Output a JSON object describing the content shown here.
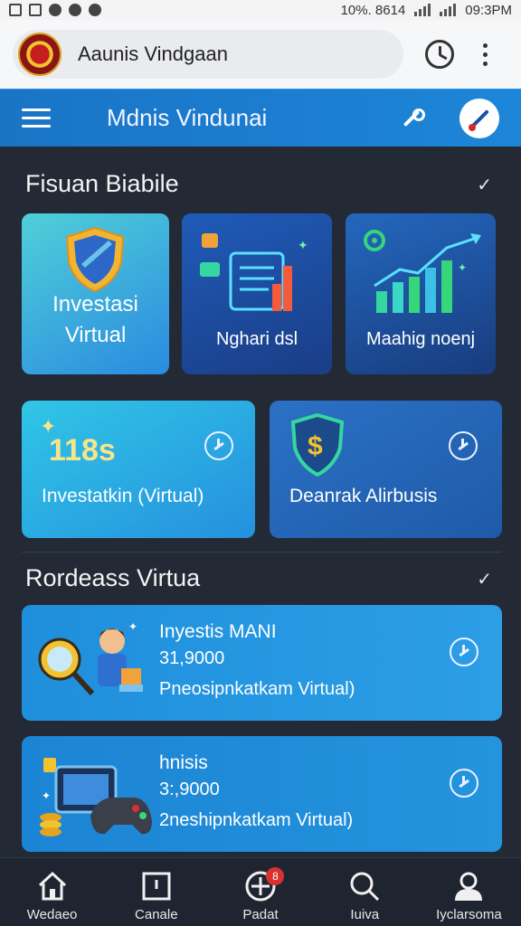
{
  "status_bar": {
    "time": "09:3PM",
    "battery_text": "10%. 8614"
  },
  "browser": {
    "url_text": "Aaunis Vindgaan"
  },
  "app_bar": {
    "title": "Mdnis Vindunai"
  },
  "section1": {
    "title": "Fisuan Biabile"
  },
  "cards": [
    {
      "label": "Investasi Virtual"
    },
    {
      "label": "Nghari dsl"
    },
    {
      "label": "Maahig noenj"
    },
    {
      "value": "118s",
      "label": "Investatkin (Virtual)"
    },
    {
      "label": "Deanrak Alirbusis"
    }
  ],
  "section2": {
    "title": "Rordeass Virtua"
  },
  "list": [
    {
      "title": "Inyestis MANI",
      "amount": "31,9000",
      "subtitle": "Pneosipnkatkam Virtual)"
    },
    {
      "title": "hnisis",
      "amount": "3:,9000",
      "subtitle": "2neshipnkatkam Virtual)"
    }
  ],
  "nav": [
    {
      "label": "Wedaeo",
      "icon": "home-icon"
    },
    {
      "label": "Canale",
      "icon": "calendar-icon"
    },
    {
      "label": "Padat",
      "icon": "add-circle-icon",
      "badge": "8"
    },
    {
      "label": "Iuiva",
      "icon": "search-icon"
    },
    {
      "label": "Iyclarsoma",
      "icon": "user-icon"
    }
  ],
  "colors": {
    "appbar": "#1a74c6",
    "background": "#232a36",
    "accent": "#2c9ee6"
  }
}
